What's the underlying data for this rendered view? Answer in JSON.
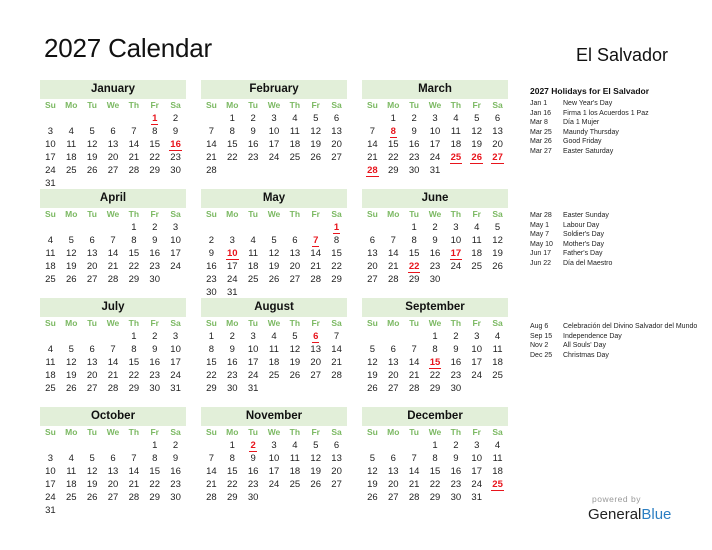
{
  "title": "2027 Calendar",
  "country": "El Salvador",
  "weekday_labels": [
    "Su",
    "Mo",
    "Tu",
    "We",
    "Th",
    "Fr",
    "Sa"
  ],
  "months": [
    {
      "name": "January",
      "start": 5,
      "days": 31,
      "holidays": [
        1,
        16
      ]
    },
    {
      "name": "February",
      "start": 1,
      "days": 28,
      "holidays": []
    },
    {
      "name": "March",
      "start": 1,
      "days": 31,
      "holidays": [
        8,
        25,
        26,
        27,
        28
      ]
    },
    {
      "name": "April",
      "start": 4,
      "days": 30,
      "holidays": []
    },
    {
      "name": "May",
      "start": 6,
      "days": 31,
      "holidays": [
        1,
        7,
        10
      ]
    },
    {
      "name": "June",
      "start": 2,
      "days": 30,
      "holidays": [
        17,
        22
      ]
    },
    {
      "name": "July",
      "start": 4,
      "days": 31,
      "holidays": []
    },
    {
      "name": "August",
      "start": 0,
      "days": 31,
      "holidays": [
        6
      ]
    },
    {
      "name": "September",
      "start": 3,
      "days": 30,
      "holidays": [
        15
      ]
    },
    {
      "name": "October",
      "start": 5,
      "days": 31,
      "holidays": []
    },
    {
      "name": "November",
      "start": 1,
      "days": 30,
      "holidays": [
        2
      ]
    },
    {
      "name": "December",
      "start": 3,
      "days": 31,
      "holidays": [
        25
      ]
    }
  ],
  "holidays_title": "2027 Holidays for El Salvador",
  "holiday_groups": [
    [
      {
        "date": "Jan 1",
        "name": "New Year's Day"
      },
      {
        "date": "Jan 16",
        "name": "Firma 1 los Acuerdos 1 Paz"
      },
      {
        "date": "Mar 8",
        "name": "Día 1  Mujer"
      },
      {
        "date": "Mar 25",
        "name": "Maundy Thursday"
      },
      {
        "date": "Mar 26",
        "name": "Good Friday"
      },
      {
        "date": "Mar 27",
        "name": "Easter Saturday"
      }
    ],
    [
      {
        "date": "Mar 28",
        "name": "Easter Sunday"
      },
      {
        "date": "May 1",
        "name": "Labour Day"
      },
      {
        "date": "May 7",
        "name": "Soldier's Day"
      },
      {
        "date": "May 10",
        "name": "Mother's Day"
      },
      {
        "date": "Jun 17",
        "name": "Father's Day"
      },
      {
        "date": "Jun 22",
        "name": "Día del Maestro"
      }
    ],
    [
      {
        "date": "Aug 6",
        "name": "Celebración del Divino Salvador del Mundo"
      },
      {
        "date": "Sep 15",
        "name": "Independence Day"
      },
      {
        "date": "Nov 2",
        "name": "All Souls' Day"
      },
      {
        "date": "Dec 25",
        "name": "Christmas Day"
      }
    ],
    []
  ],
  "footer": {
    "powered_by": "powered by",
    "brand_general": "General",
    "brand_blue": "Blue"
  },
  "colors": {
    "header_bg": "#e2efd9",
    "weekday": "#7cb963",
    "holiday": "#e8141c",
    "brand_blue": "#2b7ec2"
  }
}
